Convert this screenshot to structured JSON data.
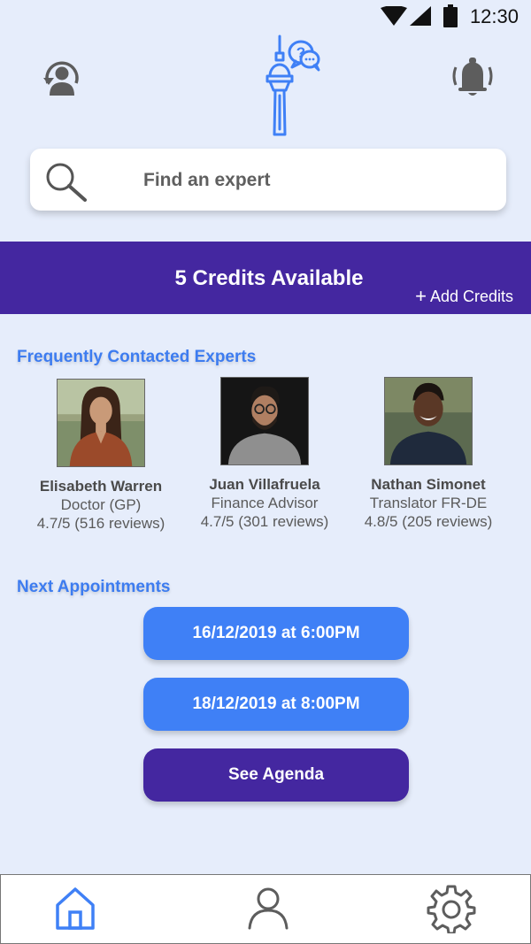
{
  "status_bar": {
    "time": "12:30"
  },
  "header": {
    "profile_icon": "account-circle-icon",
    "logo_icon": "tower-question-logo",
    "notification_icon": "bell-icon"
  },
  "search": {
    "placeholder": "Find an expert",
    "icon": "search-icon"
  },
  "credits": {
    "label": "5 Credits Available",
    "add_label": "Add Credits"
  },
  "experts": {
    "title": "Frequently Contacted Experts",
    "items": [
      {
        "name": "Elisabeth Warren",
        "role": "Doctor (GP)",
        "rating": "4.7/5 (516 reviews)"
      },
      {
        "name": "Juan Villafruela",
        "role": "Finance Advisor",
        "rating": "4.7/5 (301 reviews)"
      },
      {
        "name": "Nathan Simonet",
        "role": "Translator FR-DE",
        "rating": "4.8/5 (205 reviews)"
      }
    ]
  },
  "appointments": {
    "title": "Next Appointments",
    "items": [
      {
        "label": "16/12/2019 at 6:00PM"
      },
      {
        "label": "18/12/2019 at 8:00PM"
      }
    ],
    "agenda_label": "See Agenda"
  },
  "bottom_nav": {
    "items": [
      {
        "icon": "home-icon",
        "active": true
      },
      {
        "icon": "person-icon",
        "active": false
      },
      {
        "icon": "gear-icon",
        "active": false
      }
    ]
  },
  "colors": {
    "background": "#e6edfb",
    "accent_blue": "#3f80f6",
    "brand_purple": "#4427a0"
  }
}
